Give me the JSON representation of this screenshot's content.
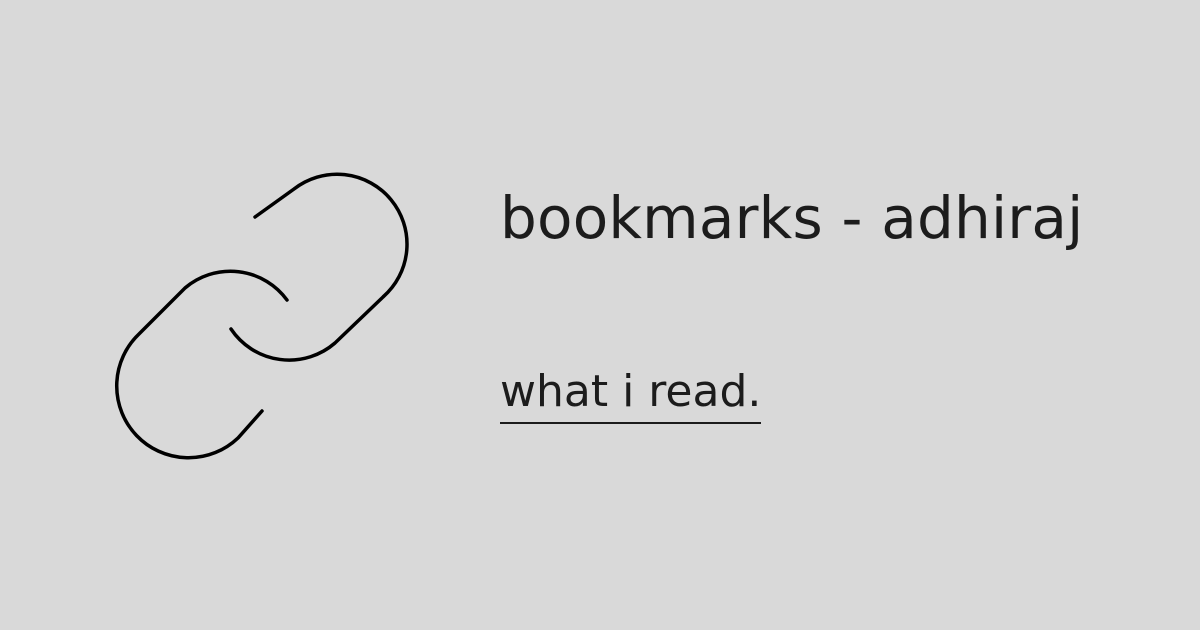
{
  "icon": {
    "name": "link-icon"
  },
  "page": {
    "title": "bookmarks - adhiraj",
    "subtitle": "what i read."
  },
  "colors": {
    "background": "#d9d9d9",
    "text": "#1c1c1c",
    "icon_stroke": "#000000"
  }
}
